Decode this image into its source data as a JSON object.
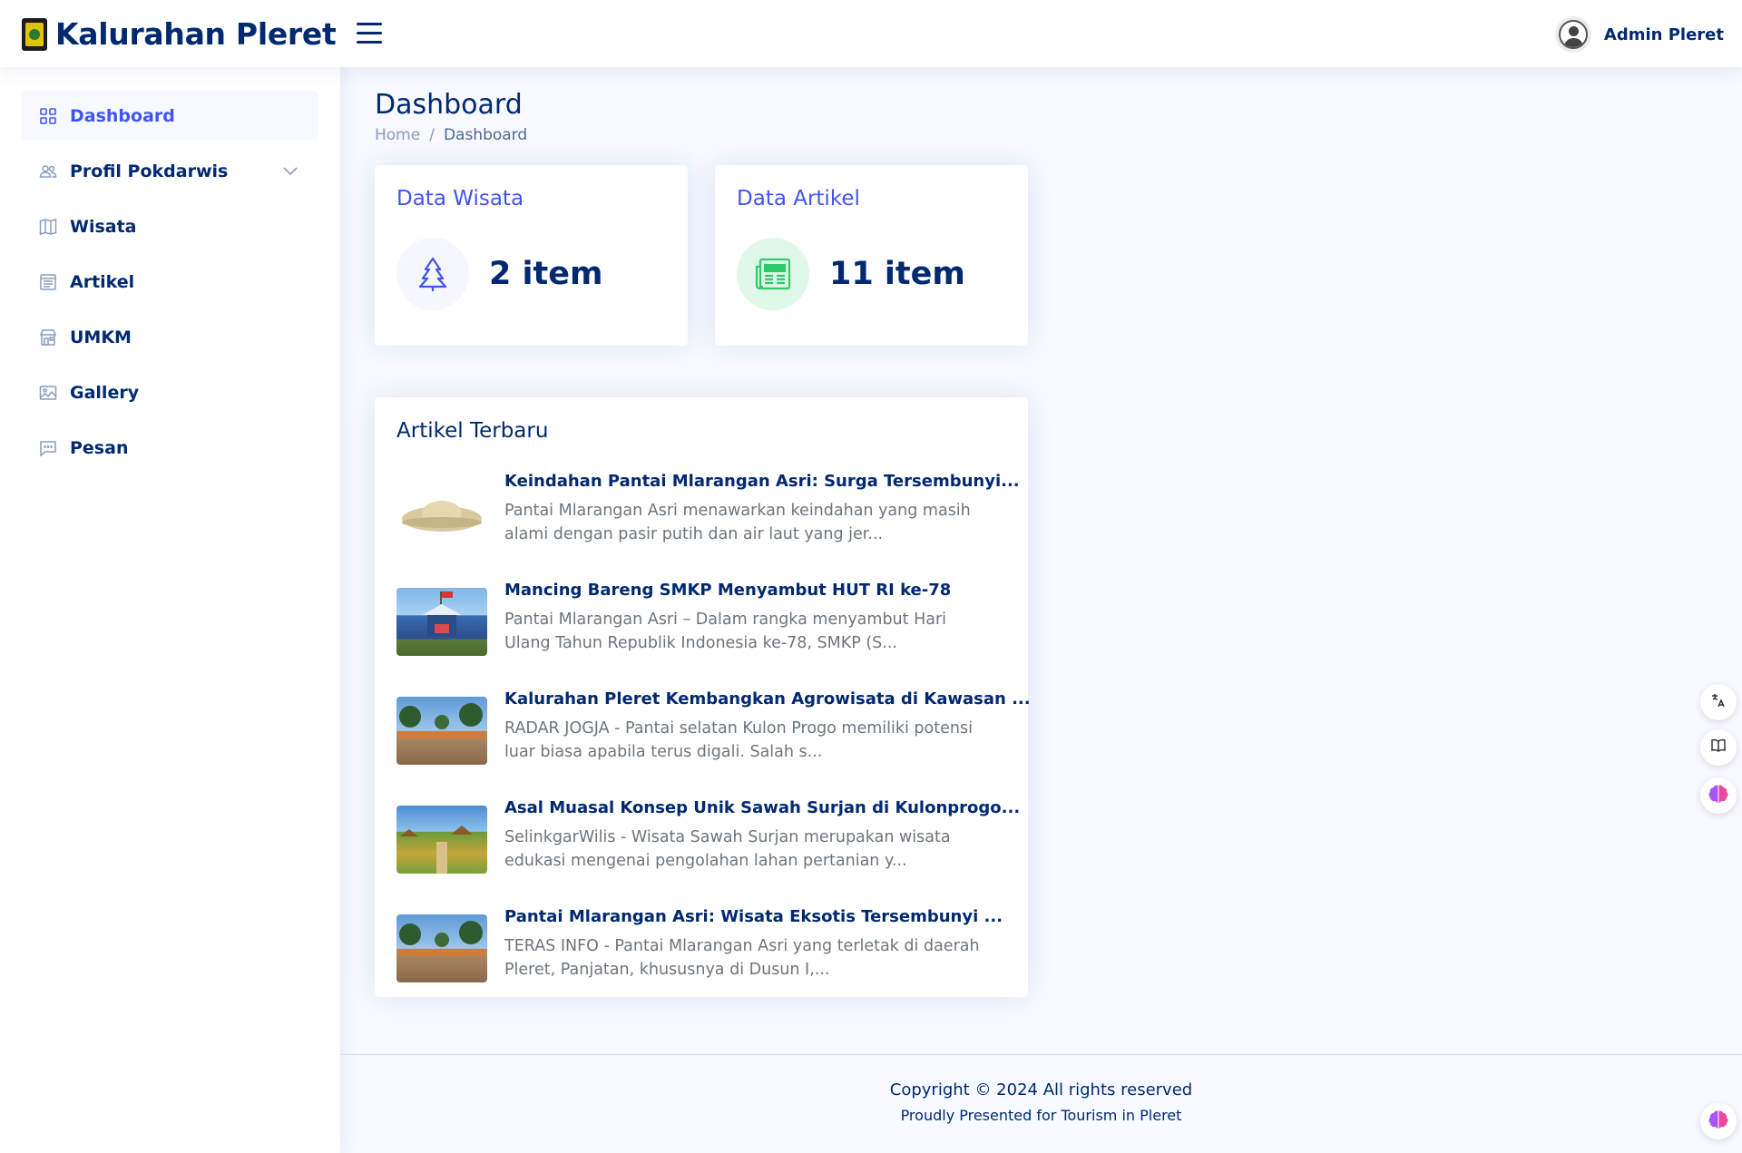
{
  "header": {
    "app_title": "Kalurahan Pleret",
    "user_name": "Admin Pleret"
  },
  "sidebar": {
    "items": [
      {
        "label": "Dashboard",
        "icon": "grid-icon",
        "active": true
      },
      {
        "label": "Profil Pokdarwis",
        "icon": "people-icon",
        "has_submenu": true
      },
      {
        "label": "Wisata",
        "icon": "map-icon"
      },
      {
        "label": "Artikel",
        "icon": "layout-text-icon"
      },
      {
        "label": "UMKM",
        "icon": "shop-icon"
      },
      {
        "label": "Gallery",
        "icon": "image-icon"
      },
      {
        "label": "Pesan",
        "icon": "chat-icon"
      }
    ]
  },
  "page": {
    "title": "Dashboard",
    "breadcrumb": [
      "Home",
      "Dashboard"
    ]
  },
  "cards": {
    "wisata": {
      "title": "Data Wisata",
      "count": "2 item",
      "icon": "tree-icon"
    },
    "artikel": {
      "title": "Data Artikel",
      "count": "11 item",
      "icon": "newspaper-icon"
    }
  },
  "recent_articles": {
    "title": "Artikel Terbaru",
    "items": [
      {
        "title": "Keindahan Pantai Mlarangan Asri: Surga Tersembunyi...",
        "desc": "Pantai Mlarangan Asri menawarkan keindahan yang masih alami dengan pasir putih dan air laut yang jer..."
      },
      {
        "title": "Mancing Bareng SMKP Menyambut HUT RI ke-78",
        "desc": "Pantai Mlarangan Asri – Dalam rangka menyambut Hari Ulang Tahun Republik Indonesia ke-78, SMKP (S..."
      },
      {
        "title": "Kalurahan Pleret Kembangkan Agrowisata di Kawasan ...",
        "desc": "RADAR JOGJA - Pantai selatan Kulon Progo memiliki potensi luar biasa apabila terus digali. Salah s..."
      },
      {
        "title": "Asal Muasal Konsep Unik Sawah Surjan di Kulonprogo...",
        "desc": "SelinkgarWilis - Wisata Sawah Surjan merupakan wisata edukasi mengenai pengolahan lahan pertanian y..."
      },
      {
        "title": "Pantai Mlarangan Asri: Wisata Eksotis Tersembunyi ...",
        "desc": "TERAS INFO - Pantai Mlarangan Asri yang terletak di daerah Pleret, Panjatan, khususnya di Dusun I,..."
      }
    ]
  },
  "footer": {
    "copyright": "Copyright © 2024 All rights reserved",
    "credits": "Proudly Presented for Tourism in Pleret"
  },
  "colors": {
    "primary": "#4154f1",
    "navy": "#012970",
    "background": "#f6f9ff",
    "green": "#2eca6a"
  }
}
